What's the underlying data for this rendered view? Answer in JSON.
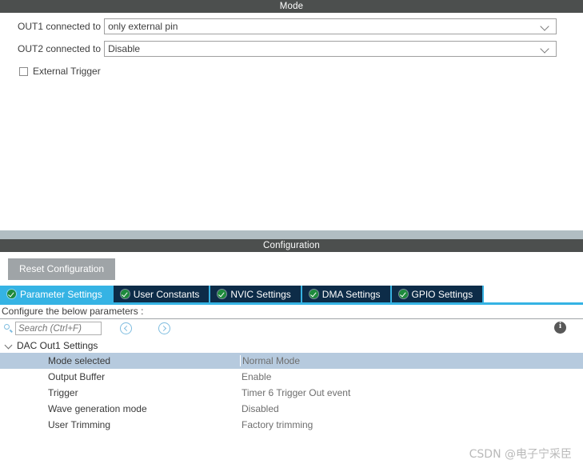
{
  "mode_panel": {
    "title": "Mode",
    "fields": [
      {
        "label": "OUT1 connected to",
        "value": "only external pin",
        "icon": "chevron-down-icon"
      },
      {
        "label": "OUT2 connected to",
        "value": "Disable",
        "icon": "chevron-down-icon"
      }
    ],
    "checkbox": {
      "label": "External Trigger",
      "checked": false
    }
  },
  "config_panel": {
    "title": "Configuration",
    "reset_label": "Reset Configuration",
    "tabs": [
      {
        "label": "Parameter Settings",
        "active": true,
        "icon": "green-check-icon"
      },
      {
        "label": "User Constants",
        "active": false,
        "icon": "green-check-icon"
      },
      {
        "label": "NVIC Settings",
        "active": false,
        "icon": "green-check-icon"
      },
      {
        "label": "DMA Settings",
        "active": false,
        "icon": "green-check-icon"
      },
      {
        "label": "GPIO Settings",
        "active": false,
        "icon": "green-check-icon"
      }
    ],
    "configure_hint": "Configure the below parameters :",
    "search": {
      "placeholder": "Search (Ctrl+F)",
      "value": "",
      "icon": "search-icon",
      "prev_icon": "chevron-left-circle-icon",
      "next_icon": "chevron-right-circle-icon",
      "info_icon": "info-icon"
    },
    "tree": {
      "group_label": "DAC Out1 Settings",
      "group_expanded": true,
      "rows": [
        {
          "name": "Mode selected",
          "value": "Normal Mode",
          "selected": true
        },
        {
          "name": "Output Buffer",
          "value": "Enable",
          "selected": false
        },
        {
          "name": "Trigger",
          "value": "Timer 6 Trigger Out event",
          "selected": false
        },
        {
          "name": "Wave generation mode",
          "value": "Disabled",
          "selected": false
        },
        {
          "name": "User Trimming",
          "value": "Factory trimming",
          "selected": false
        }
      ]
    }
  },
  "watermark": "CSDN @电子宁采臣",
  "colors": {
    "panel_header_bg": "#4c4f4e",
    "divider": "#b1bdc2",
    "tab_active_bg": "#35b3e4",
    "tab_inactive_bg": "#0d2c48",
    "row_selected_bg": "#b6cade",
    "reset_button_bg": "#9fa4a7",
    "accent_blue": "#7fbde0"
  }
}
